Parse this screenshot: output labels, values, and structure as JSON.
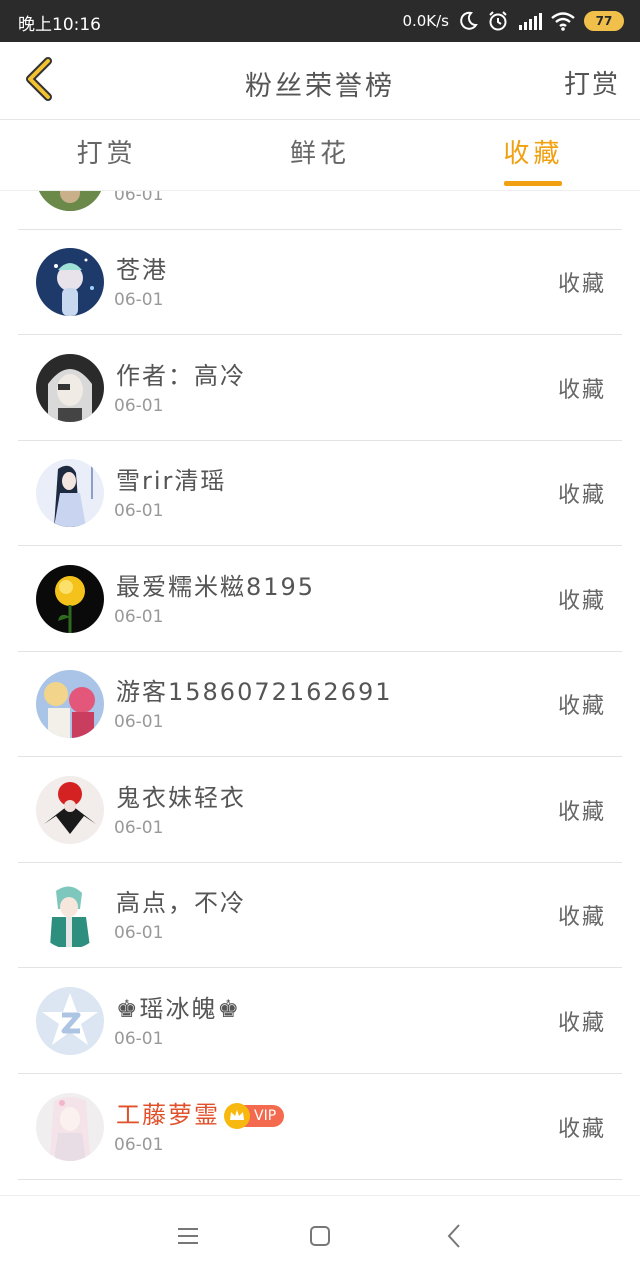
{
  "status_bar": {
    "time": "晚上10:16",
    "net_speed": "0.0K/s",
    "battery": "77"
  },
  "header": {
    "title": "粉丝荣誉榜",
    "right_action": "打赏"
  },
  "tabs": [
    {
      "label": "打赏",
      "active": false
    },
    {
      "label": "鲜花",
      "active": false
    },
    {
      "label": "收藏",
      "active": true
    }
  ],
  "rows": [
    {
      "name": "",
      "date": "06-01",
      "action": ""
    },
    {
      "name": "苍港",
      "date": "06-01",
      "action": "收藏"
    },
    {
      "name": "作者：高冷",
      "date": "06-01",
      "action": "收藏"
    },
    {
      "name": "雪rir清瑶",
      "date": "06-01",
      "action": "收藏"
    },
    {
      "name": "最爱糯米糍8195",
      "date": "06-01",
      "action": "收藏"
    },
    {
      "name": "游客1586072162691",
      "date": "06-01",
      "action": "收藏"
    },
    {
      "name": "鬼衣妹轻衣",
      "date": "06-01",
      "action": "收藏"
    },
    {
      "name": "高点，不冷",
      "date": "06-01",
      "action": "收藏"
    },
    {
      "name": "♚瑶冰魄♚",
      "date": "06-01",
      "action": "收藏"
    },
    {
      "name": "工藤萝霊",
      "vip_label": "VIP",
      "date": "06-01",
      "action": "收藏"
    }
  ],
  "colors": {
    "accent": "#f0a010",
    "vip_name": "#e0502a",
    "status_bar_bg": "#2b2b2b"
  },
  "nav": {
    "icons": [
      "menu-icon",
      "home-square-icon",
      "back-triangle-icon"
    ]
  }
}
